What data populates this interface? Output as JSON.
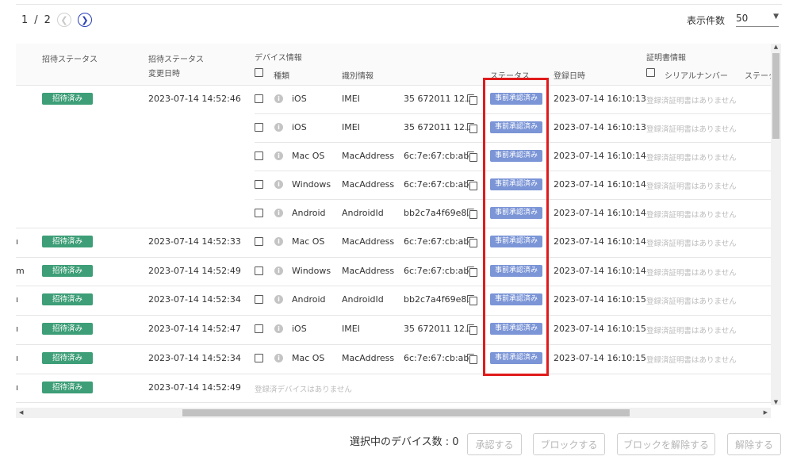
{
  "pagination": {
    "current": "1",
    "separator": "/",
    "total": "2"
  },
  "per_page": {
    "label": "表示件数",
    "value": "50"
  },
  "headers": {
    "col_a": "招待ステータス",
    "col_b_line1": "招待ステータス",
    "col_b_line2": "変更日時",
    "device_group": "デバイス情報",
    "type": "種類",
    "ident": "識別情報",
    "status": "ステータス",
    "registered": "登録日時",
    "cert_group": "証明書情報",
    "serial": "シリアルナンバー",
    "status_cut": "ステータ"
  },
  "users": [
    {
      "prefix": "",
      "status": "招待済み",
      "changed": "2023-07-14 14:52:46"
    },
    {
      "prefix": "ı",
      "status": "招待済み",
      "changed": "2023-07-14 14:52:33"
    },
    {
      "prefix": "m",
      "status": "招待済み",
      "changed": "2023-07-14 14:52:49"
    },
    {
      "prefix": "ı",
      "status": "招待済み",
      "changed": "2023-07-14 14:52:34"
    },
    {
      "prefix": "ı",
      "status": "招待済み",
      "changed": "2023-07-14 14:52:47"
    },
    {
      "prefix": "ı",
      "status": "招待済み",
      "changed": "2023-07-14 14:52:34"
    },
    {
      "prefix": "ı",
      "status": "招待済み",
      "changed": "2023-07-14 14:52:49"
    }
  ],
  "devices": [
    {
      "os": "iOS",
      "type": "IMEI",
      "id": "35 672011 12...",
      "status": "事前承認済み",
      "registered": "2023-07-14 16:10:13",
      "cert": "登録済証明書はありません"
    },
    {
      "os": "iOS",
      "type": "IMEI",
      "id": "35 672011 12...",
      "status": "事前承認済み",
      "registered": "2023-07-14 16:10:13",
      "cert": "登録済証明書はありません"
    },
    {
      "os": "Mac OS",
      "type": "MacAddress",
      "id": "6c:7e:67:cb:ab...",
      "status": "事前承認済み",
      "registered": "2023-07-14 16:10:14",
      "cert": "登録済証明書はありません"
    },
    {
      "os": "Windows",
      "type": "MacAddress",
      "id": "6c:7e:67:cb:ab...",
      "status": "事前承認済み",
      "registered": "2023-07-14 16:10:14",
      "cert": "登録済証明書はありません"
    },
    {
      "os": "Android",
      "type": "AndroidId",
      "id": "bb2c7a4f69e8...",
      "status": "事前承認済み",
      "registered": "2023-07-14 16:10:14",
      "cert": "登録済証明書はありません"
    },
    {
      "os": "Mac OS",
      "type": "MacAddress",
      "id": "6c:7e:67:cb:ab...",
      "status": "事前承認済み",
      "registered": "2023-07-14 16:10:14",
      "cert": "登録済証明書はありません"
    },
    {
      "os": "Windows",
      "type": "MacAddress",
      "id": "6c:7e:67:cb:ab...",
      "status": "事前承認済み",
      "registered": "2023-07-14 16:10:14",
      "cert": "登録済証明書はありません"
    },
    {
      "os": "Android",
      "type": "AndroidId",
      "id": "bb2c7a4f69e8...",
      "status": "事前承認済み",
      "registered": "2023-07-14 16:10:15",
      "cert": "登録済証明書はありません"
    },
    {
      "os": "iOS",
      "type": "IMEI",
      "id": "35 672011 12...",
      "status": "事前承認済み",
      "registered": "2023-07-14 16:10:15",
      "cert": "登録済証明書はありません"
    },
    {
      "os": "Mac OS",
      "type": "MacAddress",
      "id": "6c:7e:67:cb:ab...",
      "status": "事前承認済み",
      "registered": "2023-07-14 16:10:15",
      "cert": "登録済証明書はありません"
    }
  ],
  "no_devices": "登録済デバイスはありません",
  "footer": {
    "selected_label": "選択中のデバイス数 : 0",
    "approve": "承認する",
    "block": "ブロックする",
    "unblock": "ブロックを解除する",
    "remove": "解除する"
  },
  "colors": {
    "badge_green": "#3d9e77",
    "badge_blue": "#7b95d6",
    "highlight": "#e01b1b"
  }
}
